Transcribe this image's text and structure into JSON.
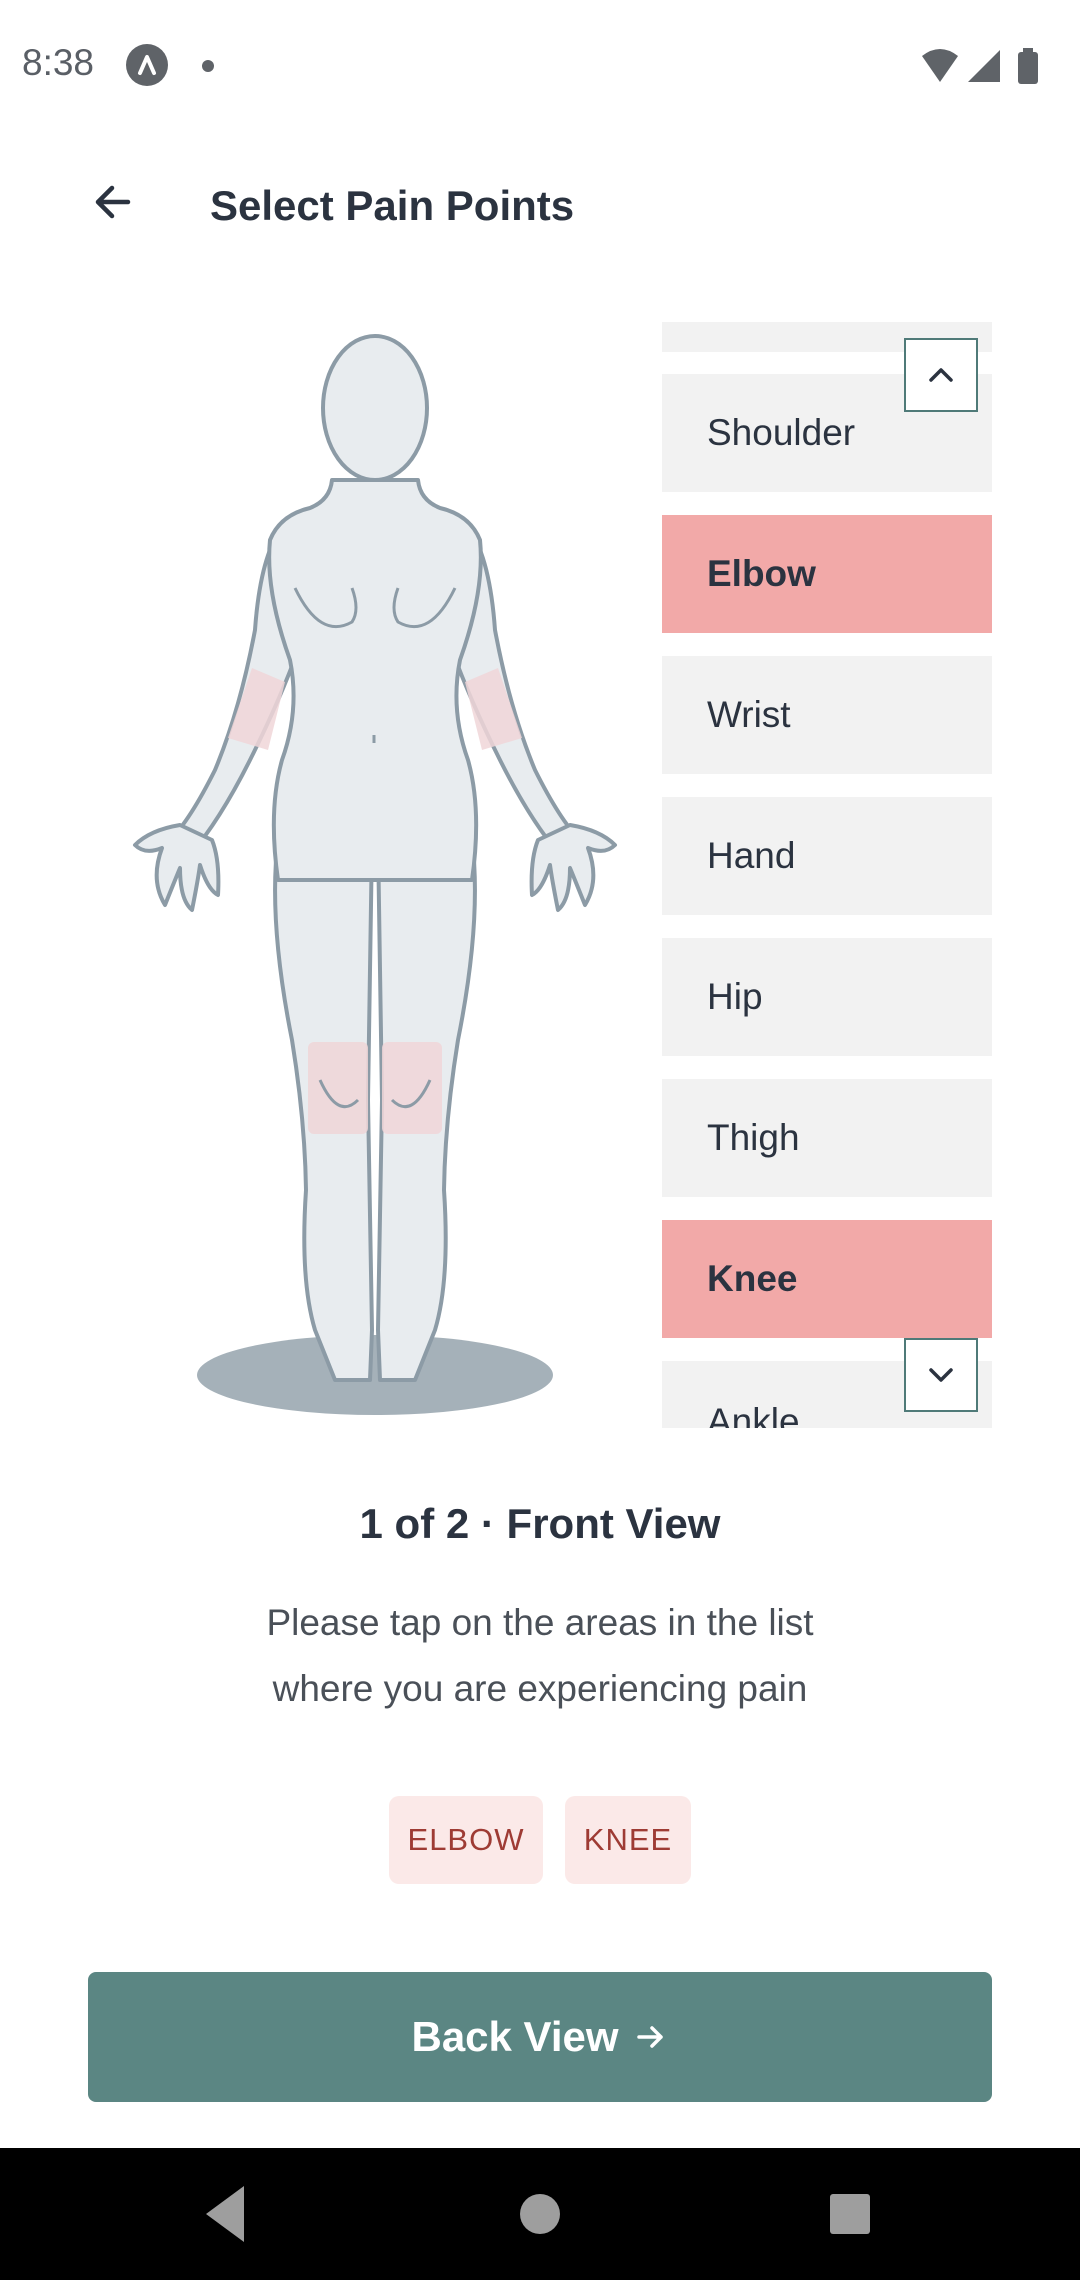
{
  "status_bar": {
    "time": "8:38"
  },
  "header": {
    "title": "Select Pain Points"
  },
  "body_parts": [
    {
      "label": "Shoulder",
      "selected": false
    },
    {
      "label": "Elbow",
      "selected": true
    },
    {
      "label": "Wrist",
      "selected": false
    },
    {
      "label": "Hand",
      "selected": false
    },
    {
      "label": "Hip",
      "selected": false
    },
    {
      "label": "Thigh",
      "selected": false
    },
    {
      "label": "Knee",
      "selected": true
    },
    {
      "label": "Ankle",
      "selected": false
    }
  ],
  "view": {
    "label": "1 of 2 · Front View",
    "instruction_line1": "Please tap on the areas in the list",
    "instruction_line2": "where you are experiencing pain"
  },
  "selected_chips": [
    "ELBOW",
    "KNEE"
  ],
  "cta": {
    "label": "Back View"
  },
  "colors": {
    "selected_item": "#f2a9a8",
    "chip_bg": "#fbe9e8",
    "chip_text": "#9e3b34",
    "cta": "#5b8683",
    "body_highlight": "#f0d6d8"
  }
}
